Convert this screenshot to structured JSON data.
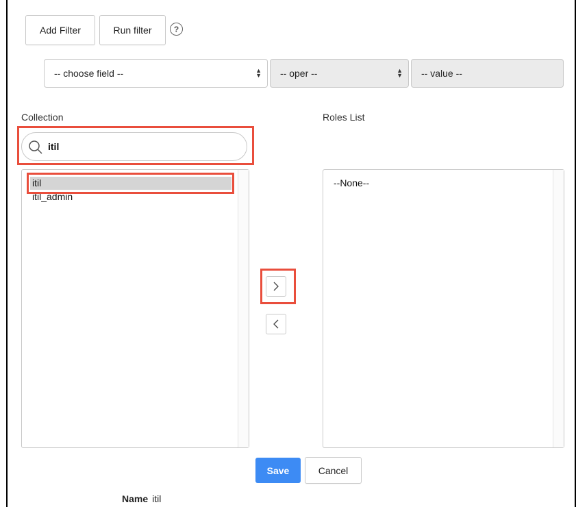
{
  "toolbar": {
    "add_filter_label": "Add Filter",
    "run_filter_label": "Run filter",
    "help_glyph": "?"
  },
  "filter_row": {
    "field_value": "-- choose field --",
    "oper_value": "-- oper --",
    "value_value": "-- value --"
  },
  "collection": {
    "label": "Collection",
    "search_value": "itil",
    "items": [
      {
        "label": "itil",
        "selected": true
      },
      {
        "label": "itil_admin",
        "selected": false
      }
    ]
  },
  "roles": {
    "label": "Roles List",
    "items": [
      {
        "label": "--None--"
      }
    ]
  },
  "actions": {
    "add_glyph": "›",
    "remove_glyph": "‹",
    "save_label": "Save",
    "cancel_label": "Cancel"
  },
  "name_field": {
    "label": "Name",
    "value": "itil"
  },
  "colors": {
    "highlight_red": "#e94e3c",
    "primary_blue": "#3d8bf4",
    "selected_gray": "#d5d5d5",
    "disabled_gray": "#ebebeb"
  },
  "icons": {
    "search": "search-icon",
    "help": "help-icon",
    "add": "chevron-right-icon",
    "remove": "chevron-left-icon"
  }
}
